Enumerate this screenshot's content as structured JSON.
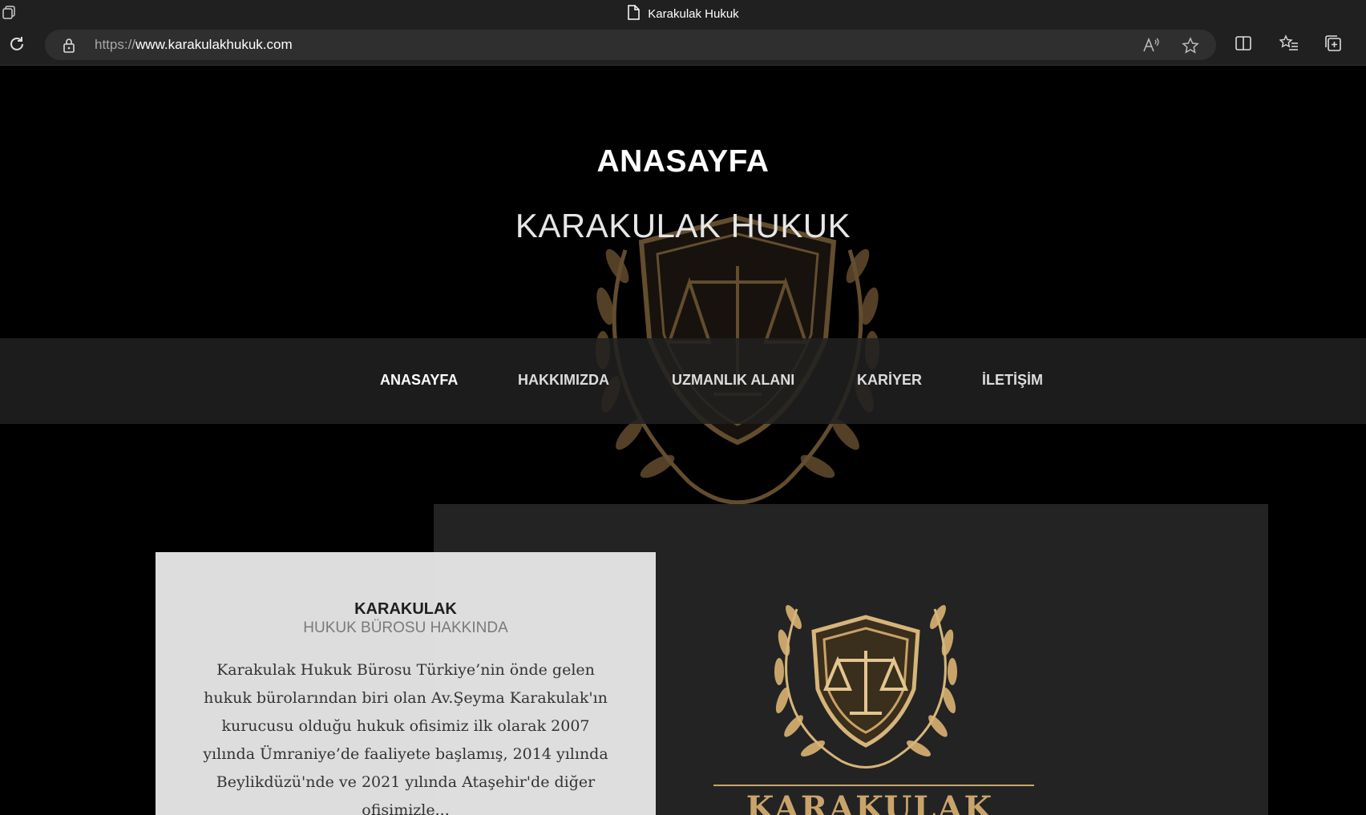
{
  "browser": {
    "tab_title": "Karakulak Hukuk",
    "url_protocol": "https://",
    "url_host": "www.karakulakhukuk.com"
  },
  "hero": {
    "title": "ANASAYFA",
    "subtitle": "KARAKULAK HUKUK"
  },
  "nav": {
    "items": [
      {
        "label": "ANASAYFA",
        "active": true
      },
      {
        "label": "HAKKIMIZDA"
      },
      {
        "label": "UZMANLIK ALANI"
      },
      {
        "label": "KARİYER"
      },
      {
        "label": "İLETİŞİM"
      }
    ]
  },
  "about": {
    "title": "KARAKULAK",
    "subtitle": "HUKUK BÜROSU HAKKINDA",
    "text": "Karakulak Hukuk Bürosu Türkiye’nin önde gelen hukuk bürolarından biri olan Av.Şeyma Karakulak'ın kurucusu olduğu hukuk ofisimiz ilk olarak 2007 yılında Ümraniye’de faaliyete başlamış, 2014 yılında Beylikdüzü'nde ve 2021 yılında Ataşehir'de diğer ofisimizle..."
  },
  "logo": {
    "wordmark": "KARAKULAK"
  },
  "colors": {
    "gold": "#c9a46a",
    "background": "#000000",
    "panel": "#232323"
  }
}
